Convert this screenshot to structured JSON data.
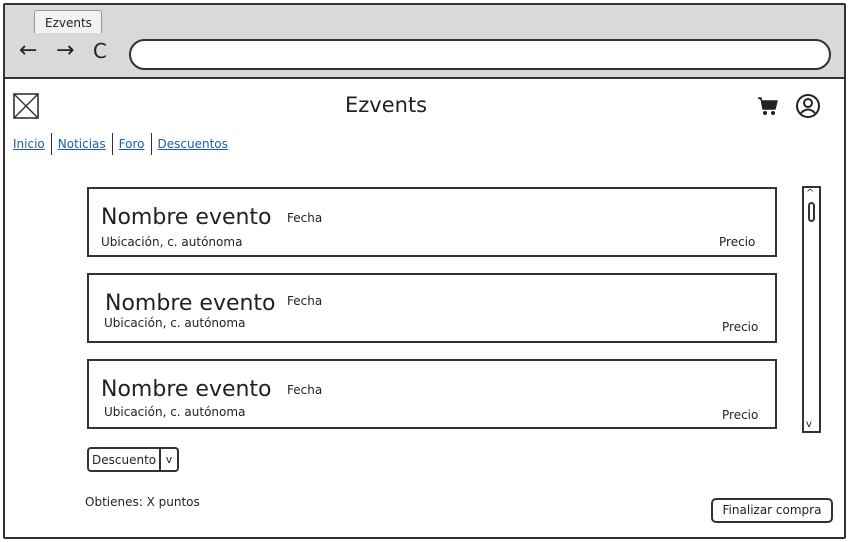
{
  "browser": {
    "tab_title": "Ezvents",
    "address_value": ""
  },
  "header": {
    "title": "Ezvents"
  },
  "nav": {
    "items": [
      "Inicio",
      "Noticias",
      "Foro",
      "Descuentos"
    ]
  },
  "events": [
    {
      "name": "Nombre evento",
      "date": "Fecha",
      "location": "Ubicación, c. autónoma",
      "price": "Precio"
    },
    {
      "name": "Nombre evento",
      "date": "Fecha",
      "location": "Ubicación, c. autónoma",
      "price": "Precio"
    },
    {
      "name": "Nombre evento",
      "date": "Fecha",
      "location": "Ubicación, c. autónoma",
      "price": "Precio"
    }
  ],
  "discount": {
    "selected": "Descuento"
  },
  "points_text": "Obtienes: X puntos",
  "checkout_label": "Finalizar compra",
  "colors": {
    "link": "#1f5fa8",
    "chrome": "#d9d9d9",
    "stroke": "#333333"
  }
}
